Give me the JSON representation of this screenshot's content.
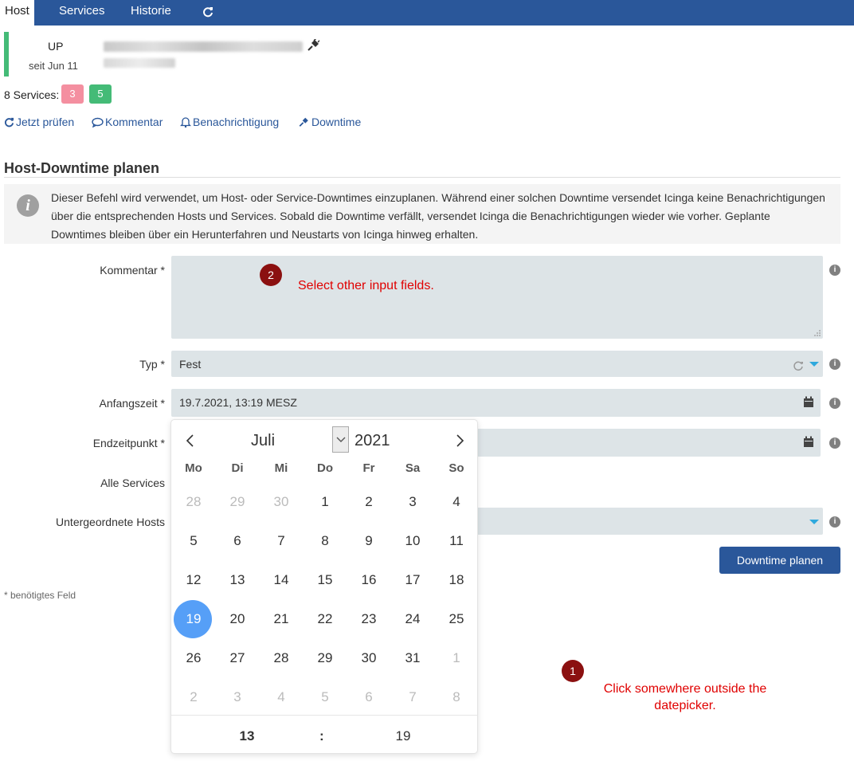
{
  "tabs": [
    {
      "label": "Host"
    },
    {
      "label": "Services"
    },
    {
      "label": "Historie"
    }
  ],
  "host": {
    "state": "UP",
    "since": "seit Jun 11"
  },
  "services": {
    "label": "8 Services:",
    "critical_count": "3",
    "ok_count": "5"
  },
  "actions": [
    {
      "label": "Jetzt prüfen",
      "icon": "refresh-icon"
    },
    {
      "label": "Kommentar",
      "icon": "comment-icon"
    },
    {
      "label": "Benachrichtigung",
      "icon": "bell-icon"
    },
    {
      "label": "Downtime",
      "icon": "plug-icon"
    }
  ],
  "section": {
    "title": "Host-Downtime planen",
    "info": "Dieser Befehl wird verwendet, um Host- oder Service-Downtimes einzuplanen. Während einer solchen Downtime versendet Icinga keine Benachrichtigungen über die entsprechenden Hosts und Services. Sobald die Downtime verfällt, versendet Icinga die Benachrichtigungen wieder wie vorher. Geplante Downtimes bleiben über ein Herunterfahren und Neustarts von Icinga hinweg erhalten."
  },
  "form": {
    "comment_label": "Kommentar *",
    "type_label": "Typ *",
    "type_value": "Fest",
    "start_label": "Anfangszeit *",
    "start_value": "19.7.2021, 13:19 MESZ",
    "end_label": "Endzeitpunkt *",
    "all_services_label": "Alle Services",
    "child_hosts_label": "Untergeordnete Hosts",
    "submit_label": "Downtime planen",
    "required_note": "* benötigtes Feld"
  },
  "datepicker": {
    "month": "Juli",
    "year": "2021",
    "weekdays": [
      "Mo",
      "Di",
      "Mi",
      "Do",
      "Fr",
      "Sa",
      "So"
    ],
    "weeks": [
      [
        "28",
        "29",
        "30",
        "1",
        "2",
        "3",
        "4"
      ],
      [
        "5",
        "6",
        "7",
        "8",
        "9",
        "10",
        "11"
      ],
      [
        "12",
        "13",
        "14",
        "15",
        "16",
        "17",
        "18"
      ],
      [
        "19",
        "20",
        "21",
        "22",
        "23",
        "24",
        "25"
      ],
      [
        "26",
        "27",
        "28",
        "29",
        "30",
        "31",
        "1"
      ],
      [
        "2",
        "3",
        "4",
        "5",
        "6",
        "7",
        "8"
      ]
    ],
    "selected_day": "19",
    "hour": "13",
    "separator": ":",
    "minute": "19"
  },
  "annotations": [
    {
      "number": "1",
      "text": "Click somewhere outside the datepicker."
    },
    {
      "number": "2",
      "text": "Select other input fields."
    }
  ],
  "colors": {
    "nav": "#2a579a",
    "ok": "#44bb77",
    "critical": "#f48fa0",
    "selected_day": "#569ff7",
    "annotation": "#e00000"
  }
}
